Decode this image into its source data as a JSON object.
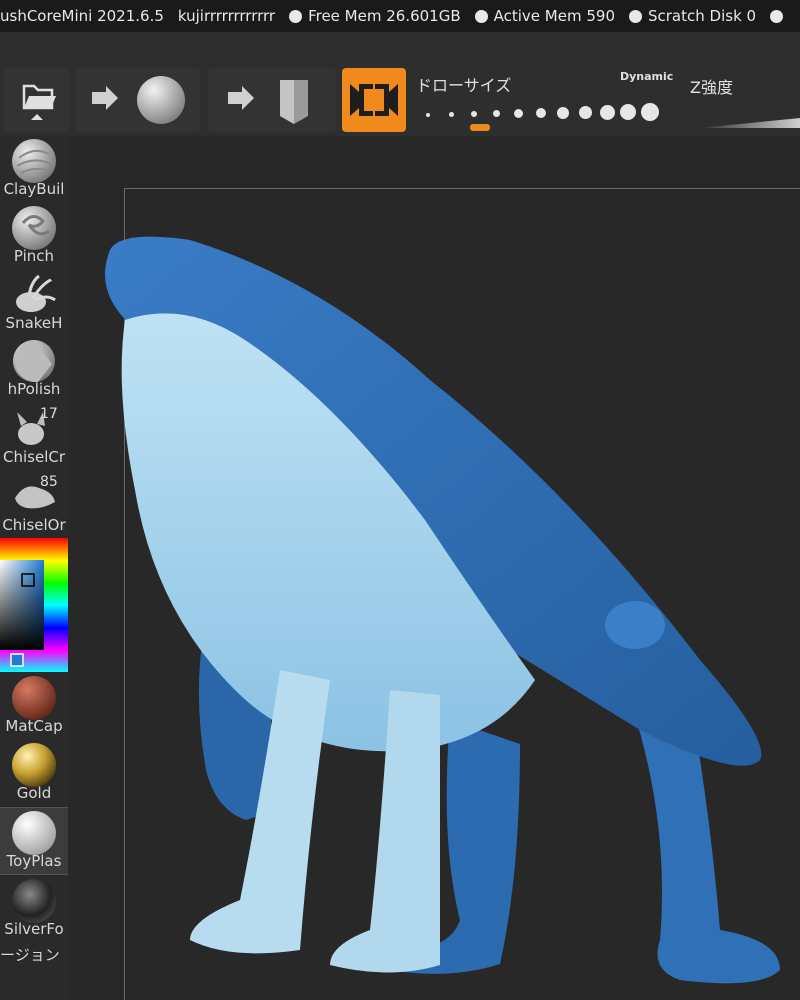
{
  "titlebar": {
    "app": "ushCoreMini 2021.6.5",
    "user": "kujirrrrrrrrrrrr",
    "free_mem": "Free Mem 26.601GB",
    "active_mem": "Active Mem 590",
    "scratch_disk": "Scratch Disk 0"
  },
  "toolbar": {
    "draw_size_label": "ドローサイズ",
    "dynamic_label": "Dynamic",
    "z_intensity_label": "Z強度"
  },
  "brushes": [
    {
      "label": "ClayBuil",
      "badge": ""
    },
    {
      "label": "Pinch",
      "badge": ""
    },
    {
      "label": "SnakeH",
      "badge": ""
    },
    {
      "label": "hPolish",
      "badge": ""
    },
    {
      "label": "ChiselCr",
      "badge": "17"
    },
    {
      "label": "ChiselOr",
      "badge": "85"
    }
  ],
  "materials": [
    {
      "label": "MatCap"
    },
    {
      "label": "Gold"
    },
    {
      "label": "ToyPlas"
    },
    {
      "label": "SilverFo"
    }
  ],
  "sidebar_bottom_label": "ージョン",
  "colors": {
    "accent": "#f08a1c",
    "model_dark": "#2f6fb5",
    "model_light": "#a9d4ec"
  }
}
